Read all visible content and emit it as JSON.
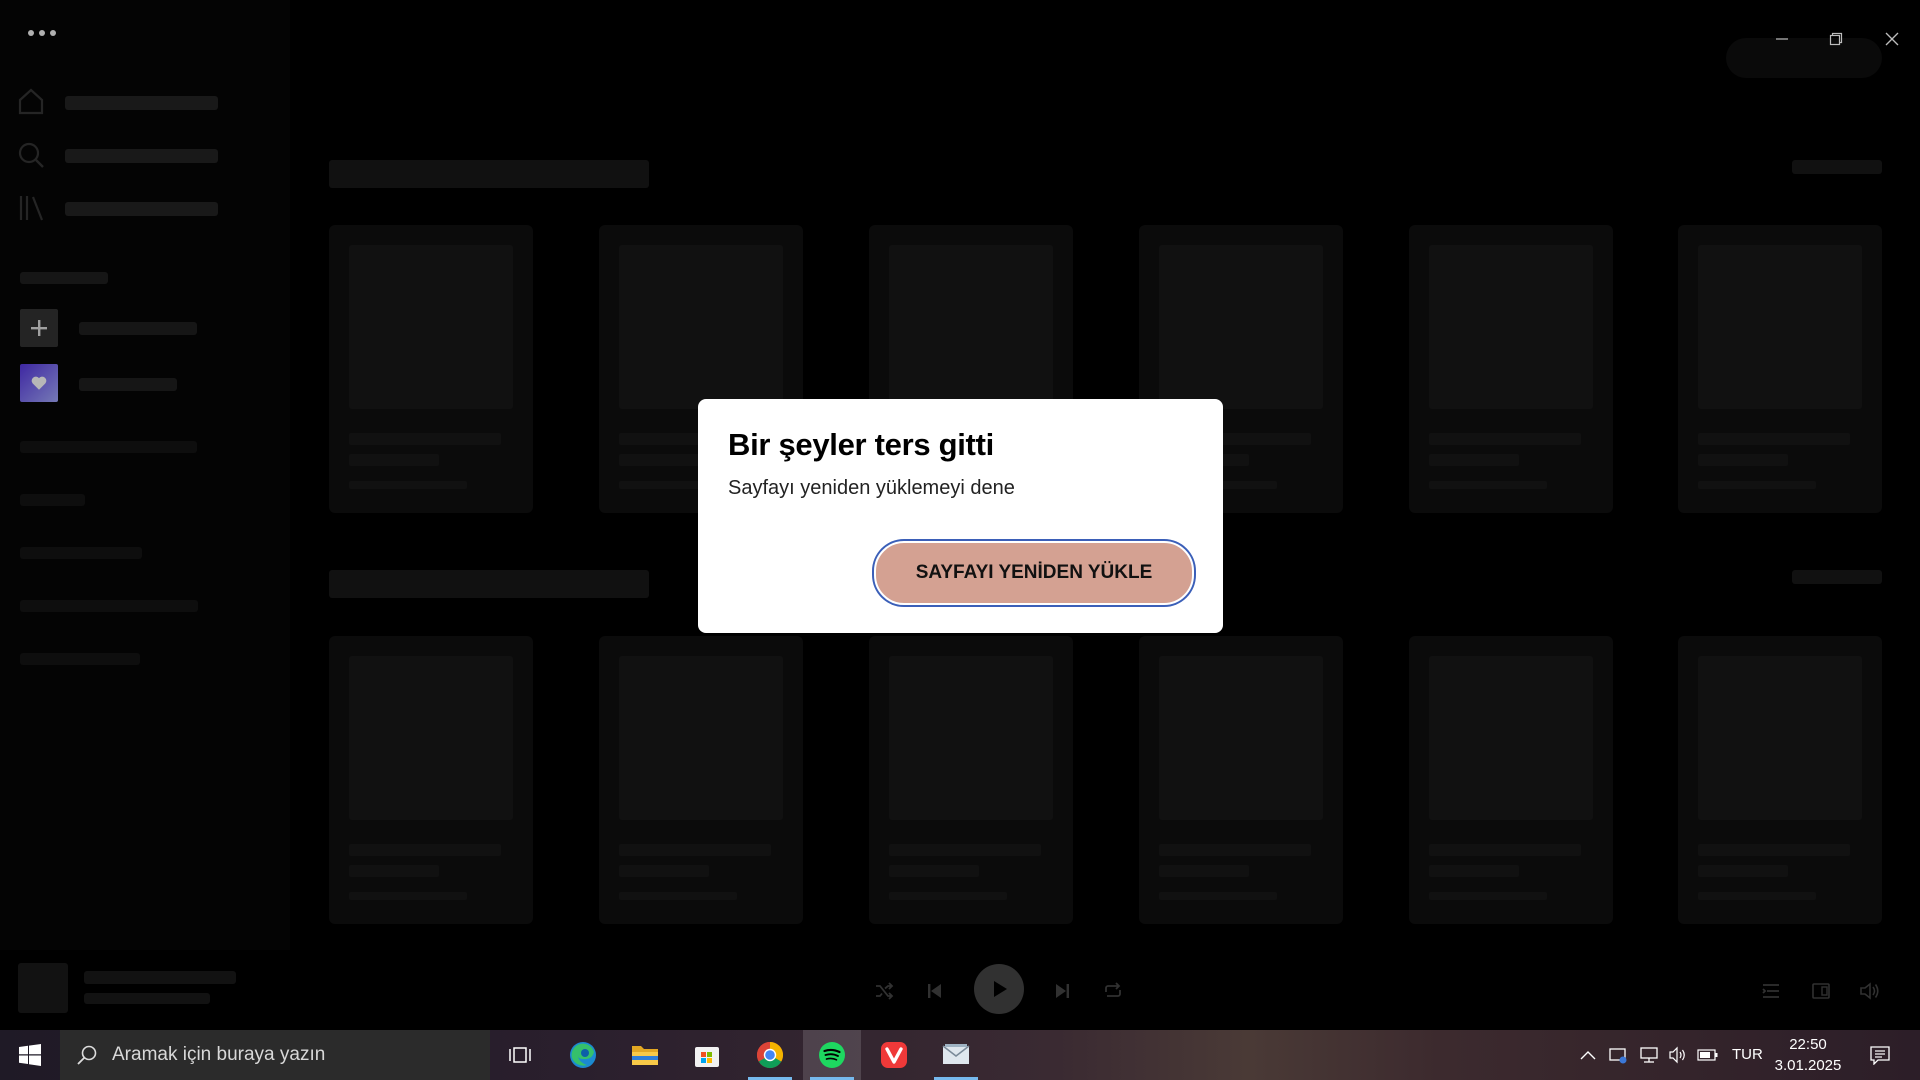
{
  "dialog": {
    "title": "Bir şeyler ters gitti",
    "message": "Sayfayı yeniden yüklemeyi dene",
    "button_label": "SAYFAYI YENİDEN YÜKLE"
  },
  "window_controls": [
    "minimize-icon",
    "restore-icon",
    "close-icon"
  ],
  "sidebar": {
    "icons": [
      "home-icon",
      "search-icon",
      "library-icon",
      "plus-icon",
      "heart-icon"
    ]
  },
  "player": {
    "icons": [
      "shuffle-icon",
      "previous-icon",
      "play-icon",
      "next-icon",
      "repeat-icon",
      "queue-icon",
      "connect-device-icon",
      "volume-icon"
    ]
  },
  "taskbar": {
    "search_placeholder": "Aramak için buraya yazın",
    "apps": [
      "task-view",
      "edge",
      "file-explorer",
      "microsoft-store",
      "chrome",
      "spotify",
      "vivaldi",
      "mail"
    ],
    "active_app": "spotify",
    "language": "TUR",
    "time": "22:50",
    "date": "3.01.2025"
  },
  "colors": {
    "dialog_button": "#d4a192",
    "focus_ring": "#3b5fb8",
    "spotify_green": "#1ed760"
  }
}
